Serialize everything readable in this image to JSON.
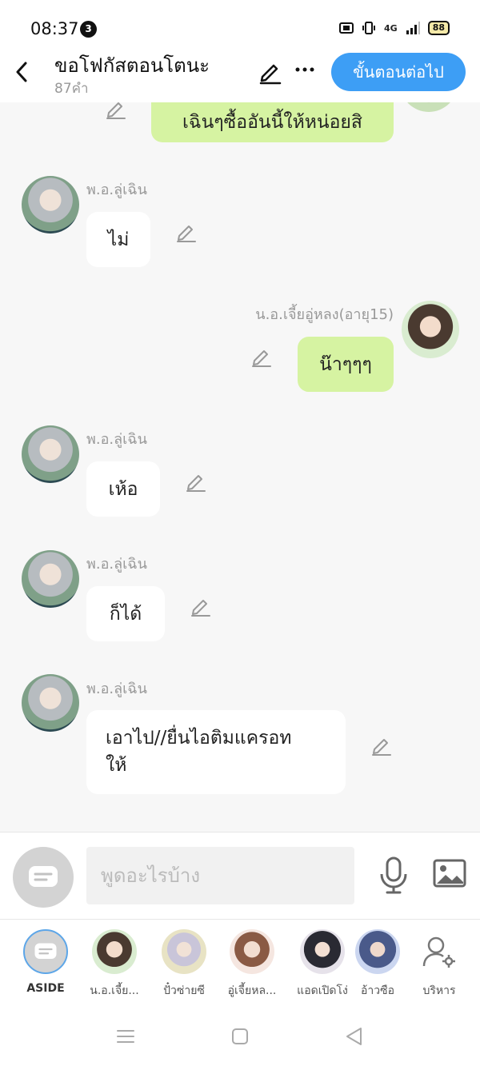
{
  "status_bar": {
    "time": "08:37",
    "notification_count": "3",
    "network": "4G",
    "battery": "88"
  },
  "header": {
    "title": "ขอโฟกัสตอนโตนะ",
    "word_count": "87คำ",
    "next_button": "ขั้นตอนต่อไป"
  },
  "messages": [
    {
      "side": "right",
      "text": "เฉินๆซื้ออันนี้ให้หน่อยสิ"
    },
    {
      "side": "left",
      "sender": "พ.อ.ลู่เฉิน",
      "text": "ไม่"
    },
    {
      "side": "right",
      "sender": "น.อ.เจี้ยอู่หลง(อายุ15)",
      "text": "น๊าๆๆๆ"
    },
    {
      "side": "left",
      "sender": "พ.อ.ลู่เฉิน",
      "text": "เห้อ"
    },
    {
      "side": "left",
      "sender": "พ.อ.ลู่เฉิน",
      "text": "ก็ได้"
    },
    {
      "side": "left",
      "sender": "พ.อ.ลู่เฉิน",
      "text_line1": "เอาไป//ยื่นไอติมแครอท",
      "text_line2": "ให้"
    }
  ],
  "composer": {
    "placeholder": "พูดอะไรบ้าง"
  },
  "characters": [
    {
      "label": "ASIDE"
    },
    {
      "label": "น.อ.เจี้ย..."
    },
    {
      "label": "ปั๋วซ่ายซี"
    },
    {
      "label": "อู่เจี้ยหล..."
    },
    {
      "label": "แอดเปิดโง่"
    },
    {
      "label": "อ้าวซือ"
    },
    {
      "label": "บริหาร"
    }
  ],
  "colors": {
    "accent": "#3d9ef5",
    "bubble_right": "#d6f3a2",
    "bubble_left": "#ffffff",
    "background": "#f7f7f7"
  }
}
